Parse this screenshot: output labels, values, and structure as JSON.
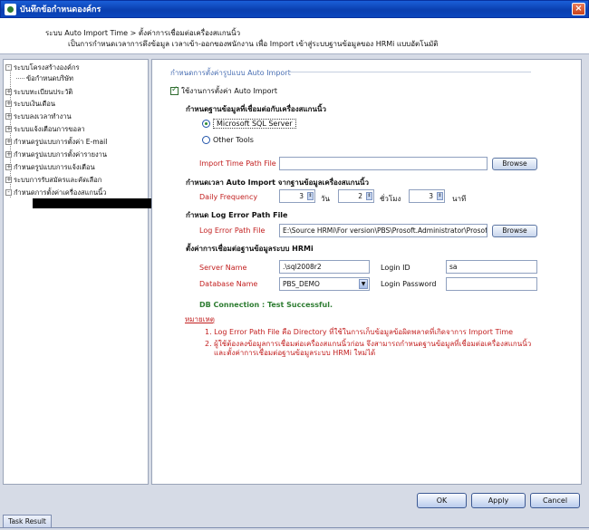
{
  "window": {
    "title": "บันทึกข้อกำหนดองค์กร",
    "close": "×"
  },
  "header": {
    "line1": "ระบบ Auto Import Time > ตั้งค่าการเชื่อมต่อเครื่องสแกนนิ้ว",
    "line2": "เป็นการกำหนดเวลาการดึงข้อมูล เวลาเข้า-ออกของพนักงาน เพื่อ Import เข้าสู่ระบบฐานข้อมูลของ HRMi แบบอัตโนมัติ"
  },
  "tree": {
    "items": [
      {
        "label": "ระบบโครงสร้างองค์กร",
        "expander": "-"
      },
      {
        "label": "ข้อกำหนดบริษัท",
        "expander": ""
      },
      {
        "label": "ระบบทะเบียนประวัติ",
        "expander": "+"
      },
      {
        "label": "ระบบเงินเดือน",
        "expander": "+"
      },
      {
        "label": "ระบบลงเวลาทำงาน",
        "expander": "+"
      },
      {
        "label": "ระบบแจ้งเตือนการขอลา",
        "expander": "+"
      },
      {
        "label": "กำหนดรูปแบบการตั้งค่า E-mail",
        "expander": "+"
      },
      {
        "label": "กำหนดรูปแบบการตั้งค่ารายงาน",
        "expander": "+"
      },
      {
        "label": "กำหนดรูปแบบการแจ้งเตือน",
        "expander": "+"
      },
      {
        "label": "ระบบการรับสมัครและคัดเลือก",
        "expander": "+"
      },
      {
        "label": "กำหนดการตั้งค่าเครื่องสแกนนิ้ว",
        "expander": "-"
      }
    ]
  },
  "panel": {
    "group_title": "กำหนดการตั้งค่ารูปแบบ Auto Import",
    "use_auto_import": "ใช้งานการตั้งค่า Auto Import",
    "section_db": "กำหนดฐานข้อมูลที่เชื่อมต่อกับเครื่องสแกนนิ้ว",
    "radio_sql": "Microsoft SQL Server",
    "radio_other": "Other Tools",
    "import_path_label": "Import Time Path File",
    "import_path_value": "",
    "browse": "Browse",
    "section_time": "กำหนดเวลา Auto Import จากฐานข้อมูลเครื่องสแกนนิ้ว",
    "daily_freq_label": "Daily Frequency",
    "day_value": "3",
    "day_unit": "วัน",
    "hour_value": "2",
    "hour_unit": "ชั่วโมง",
    "minute_value": "3",
    "minute_unit": "นาที",
    "section_log": "กำหนด Log Error Path File",
    "log_path_label": "Log Error Path File",
    "log_path_value": "E:\\Source HRMi\\For version\\PBS\\Prosoft.Administrator\\Prosof",
    "section_conn": "ตั้งค่าการเชื่อมต่อฐานข้อมูลระบบ HRMi",
    "server_label": "Server Name",
    "server_value": ".\\sql2008r2",
    "login_id_label": "Login ID",
    "login_id_value": "sa",
    "db_label": "Database Name",
    "db_value": "PBS_DEMO",
    "login_pw_label": "Login Password",
    "login_pw_value": "",
    "db_status": "DB Connection : Test Successful.",
    "note_title": "หมายเหตุ",
    "note1": "1. Log Error Path File คือ Directory ที่ใช้ในการเก็บข้อมูลข้อผิดพลาดที่เกิดจาการ Import Time",
    "note2a": "2. ผู้ใช้ต้องลงข้อมูลการเชื่อมต่อเครื่องสแกนนิ้วก่อน จึงสามารถกำหนดฐานข้อมูลที่เชื่อมต่อเครื่องสแกนนิ้ว",
    "note2b": "และตั้งค่าการเชื่อมต่อฐานข้อมูลระบบ HRMi ใหม่ได้"
  },
  "footer": {
    "ok": "OK",
    "apply": "Apply",
    "cancel": "Cancel",
    "tab": "Task Result"
  }
}
